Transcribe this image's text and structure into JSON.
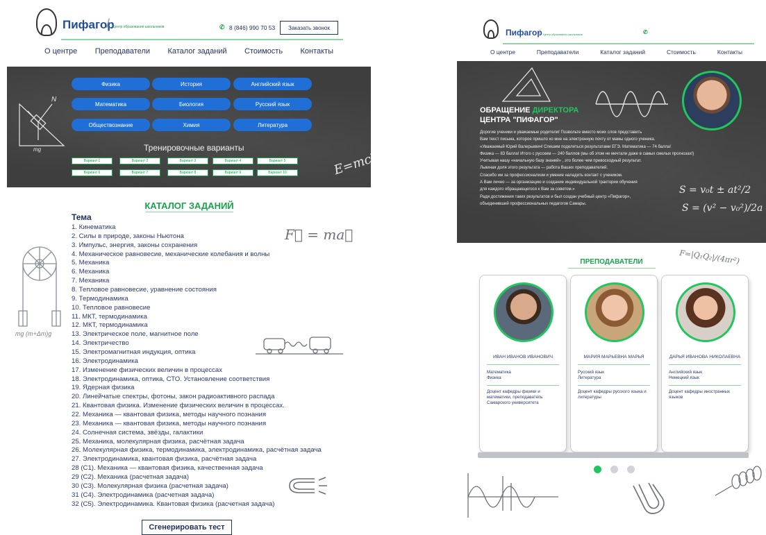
{
  "brand": {
    "name": "Пифагор",
    "subtitle": "Центр образования школьников",
    "phone": "8 (846) 990 70 53",
    "call_button": "Заказать звонок"
  },
  "nav": [
    "О центре",
    "Преподаватели",
    "Каталог заданий",
    "Стоимость",
    "Контакты"
  ],
  "subjects": [
    "Физика",
    "История",
    "Английский язык",
    "Математика",
    "Биология",
    "Русский язык",
    "Обществознание",
    "Химия",
    "Литература"
  ],
  "variants_title": "Тренировочные варианты",
  "variants": [
    "Вариант 1",
    "Вариант 2",
    "Вариант 3",
    "Вариант 4",
    "Вариант 5",
    "Вариант 6",
    "Вариант 7",
    "Вариант 8",
    "Вариант 9",
    "Вариант 10"
  ],
  "catalog": {
    "heading": "КАТАЛОГ ЗАДАНИЙ",
    "tema_label": "Тема",
    "topics": [
      "1. Кинематика",
      "2. Силы в природе, законы Ньютона",
      "3. Импульс, энергия, законы сохранения",
      "4. Механическое равновесие, механические колебания и волны",
      "5. Механика",
      "6. Механика",
      "7. Механика",
      "8. Тепловое равновесие, уравнение состояния",
      "9. Термодинамика",
      "10. Тепловое равновесие",
      "11. МКТ, термодинамика",
      "12. МКТ, термодинамика",
      "13. Электрическое поле, магнитное поле",
      "14. Электричество",
      "15. Электромагнитная индукция, оптика",
      "16. Электродинамика",
      "17. Изменение физических величин в процессах",
      "18. Электродинамика, оптика, СТО. Установление соответствия",
      "19. Ядерная физика",
      "20. Линейчатые спектры, фотоны, закон радиоактивного распада",
      "21. Квантовая физика. Изменение физических величин в процессах.",
      "22. Механика — квантовая физика, методы научного познания",
      "23. Механика — квантовая физика, методы научного познания",
      "24. Солнечная система, звёзды, галактики",
      "25. Механика, молекулярная физика, расчётная задача",
      "26. Молекулярная физика, термодинамика, электродинамика, расчётная задача",
      "27. Электродинамика, квантовая физика, расчётная задача",
      "28 (С1). Механика — квантовая физика, качественная задача",
      "29 (С2). Механика (расчетная задача)",
      "30 (С3). Молекулярная физика (расчетная задача)",
      "31 (С4). Электродинамика (расчетная задача)",
      "32 (С5). Электродинамика. Квантовая физика (расчетная задача)"
    ],
    "generate_button": "Сгенерировать тест"
  },
  "director": {
    "title_line1_a": "ОБРАЩЕНИЕ ",
    "title_line1_b": "ДИРЕКТОРА",
    "title_line2": "ЦЕНТРА \"ПИФАГОР\"",
    "letter": [
      "Дорогие ученики и уважаемые родители! Позвольте вместо моих слов представить",
      "Вам текст письма, которое пришло ко мне на электронную почту от мамы одного ученика.",
      "«Уважаемый Юрий Валерьевич! Спешим поделиться результатами ЕГЭ. Математика — 74 балла!",
      "Физика — 83 балла! Итого с русским — 240 баллов (мы об этом не мечтали даже в самых смелых прогнозах!)",
      "Учитывая нашу «начальную базу знаний» , это более чем превосходный результат.",
      "Львиная доля этого результата — работа Ваших преподавателей.",
      "Спасибо им за профессионализм и умение наладить контакт с учеником.",
      "А Вам лично — за организацию и создание индивидуальной трактории обучения",
      "для каждого обращающегося к Вам за советом.»",
      "Ради достижения таких результатов и был создан учебный центр «Пифагор»,",
      "объединивший профессиональных педагогов Самары."
    ]
  },
  "teachers": {
    "heading": "ПРЕПОДАВАТЕЛИ",
    "list": [
      {
        "name": "ИВАН ИВАНОВ ИВАНОВИЧ",
        "subject1": "Математика",
        "subject2": "Физика",
        "desc": "Доцент кафедры физики и математики, преподаватель Самарского университета"
      },
      {
        "name": "МАРИЯ МАРЬЕВНА МАРЬЯ",
        "subject1": "Русский язык",
        "subject2": "Литература",
        "desc": "Доцент кафедры русского языка и литературы"
      },
      {
        "name": "ДАРЬЯ ИВАНОВА НИКОЛАЕВНА",
        "subject1": "Английский язык",
        "subject2": "Немецкий язык",
        "desc": "Доцент кафедры иностранных языков"
      }
    ]
  },
  "colors": {
    "accent_green": "#16a34a",
    "button_blue": "#1f6fd6",
    "text_navy": "#1f2f5e",
    "chalkboard": "#3d3e3d"
  }
}
